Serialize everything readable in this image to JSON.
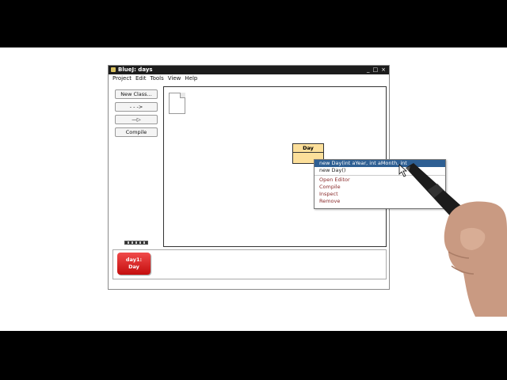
{
  "window": {
    "title": "BlueJ:  days",
    "controls": [
      "_",
      "□",
      "×"
    ]
  },
  "menu": [
    "Project",
    "Edit",
    "Tools",
    "View",
    "Help"
  ],
  "toolbar": {
    "new_class": "New Class...",
    "dependency_arrow": "- - ->",
    "inheritance_arrow": "—▷",
    "compile": "Compile"
  },
  "diagram": {
    "class_name": "Day"
  },
  "context_menu": {
    "items": [
      "new Day(int aYear, int aMonth, int aDayOfMonth)",
      "new Day()"
    ],
    "actions": [
      "Open Editor",
      "Compile",
      "Inspect",
      "Remove"
    ]
  },
  "object_bench": {
    "object_name": "day1:",
    "object_type": "Day"
  },
  "colors": {
    "class_fill": "#fcdf9a",
    "object_fill": "#d42020",
    "menu_selection": "#2e5f93"
  }
}
